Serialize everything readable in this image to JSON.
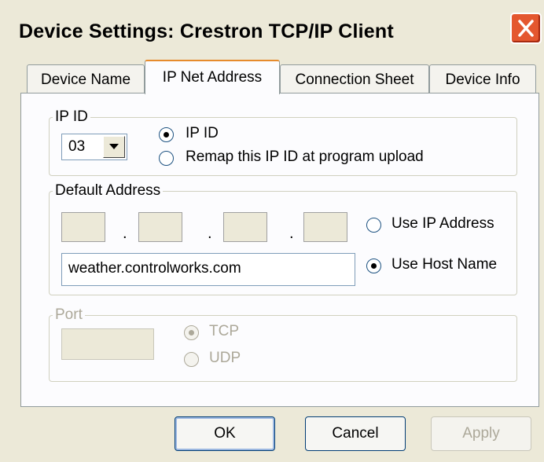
{
  "window": {
    "title": "Device Settings: Crestron TCP/IP Client"
  },
  "tabs": [
    {
      "label": "Device Name",
      "active": false
    },
    {
      "label": "IP Net Address",
      "active": true
    },
    {
      "label": "Connection Sheet",
      "active": false
    },
    {
      "label": "Device Info",
      "active": false
    }
  ],
  "ip_id_group": {
    "legend": "IP ID",
    "selected_value": "03",
    "option_ip_id": "IP ID",
    "option_remap": "Remap this IP ID at program upload",
    "selected_option": "IP ID"
  },
  "default_address": {
    "legend": "Default Address",
    "octets": [
      "",
      "",
      "",
      ""
    ],
    "separator": ".",
    "use_ip_label": "Use IP Address",
    "use_host_label": "Use Host Name",
    "host_name": "weather.controlworks.com",
    "selected_option": "Use Host Name"
  },
  "port_group": {
    "legend": "Port",
    "value": "",
    "tcp_label": "TCP",
    "udp_label": "UDP",
    "selected_option": "TCP",
    "enabled": false
  },
  "buttons": {
    "ok": "OK",
    "cancel": "Cancel",
    "apply": "Apply",
    "apply_enabled": false
  },
  "icons": {
    "close": "close-icon",
    "dropdown": "chevron-down-icon"
  },
  "colors": {
    "dialog_bg": "#ece9d8",
    "panel_bg": "#fcfcfe",
    "close_red": "#e4572f",
    "active_tab_accent": "#e68b2c",
    "disabled_text": "#aca899"
  }
}
